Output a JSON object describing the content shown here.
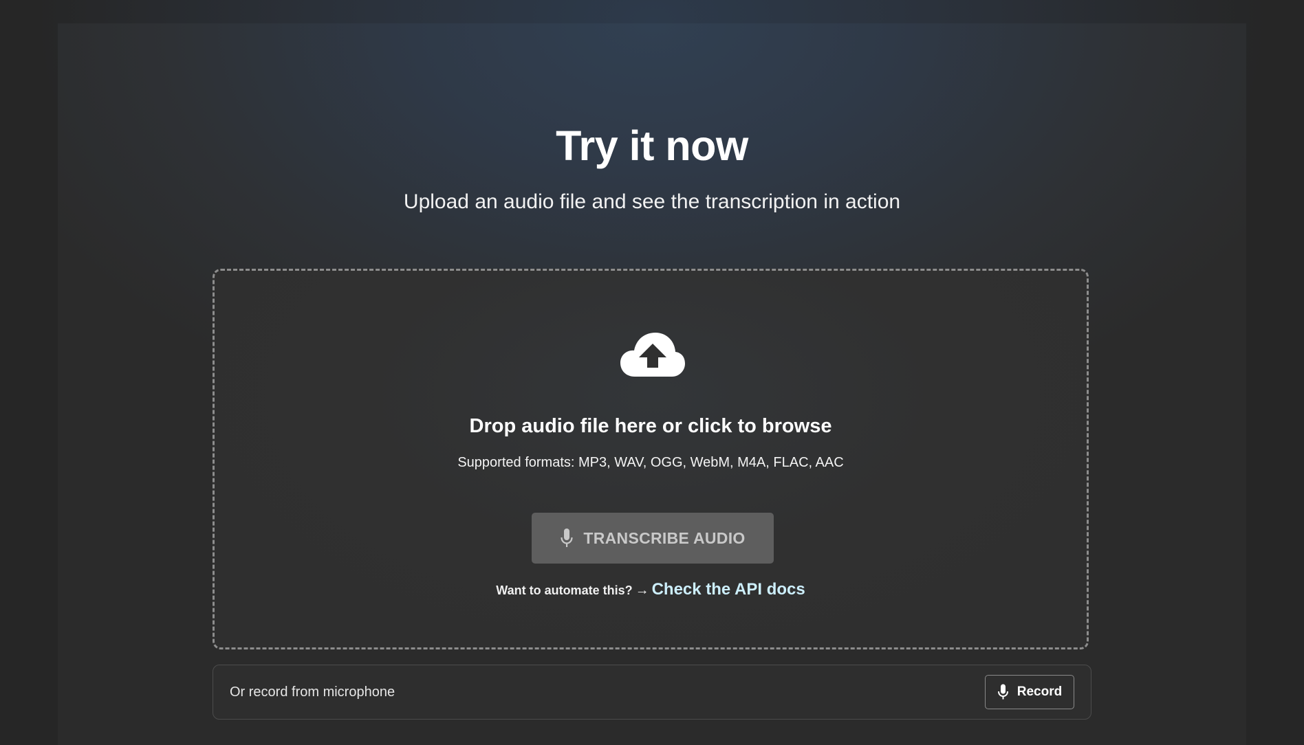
{
  "hero": {
    "title": "Try it now",
    "subtitle": "Upload an audio file and see the transcription in action"
  },
  "upload": {
    "icon": "cloud-upload-icon",
    "heading": "Drop audio file here or click to browse",
    "formats": "Supported formats: MP3, WAV, OGG, WebM, M4A, FLAC, AAC",
    "transcribe_button": {
      "label": "TRANSCRIBE AUDIO",
      "icon": "microphone-icon",
      "state": "disabled"
    },
    "api": {
      "prefix": "Want to automate this?",
      "arrow": "→",
      "link_label": "Check the API docs"
    }
  },
  "record": {
    "label": "Or record from microphone",
    "button_label": "Record",
    "button_icon": "microphone-icon"
  },
  "colors": {
    "link": "#cdeffc",
    "button_disabled_bg": "#5e5e5e",
    "dashed_border": "#8d8d8d"
  }
}
